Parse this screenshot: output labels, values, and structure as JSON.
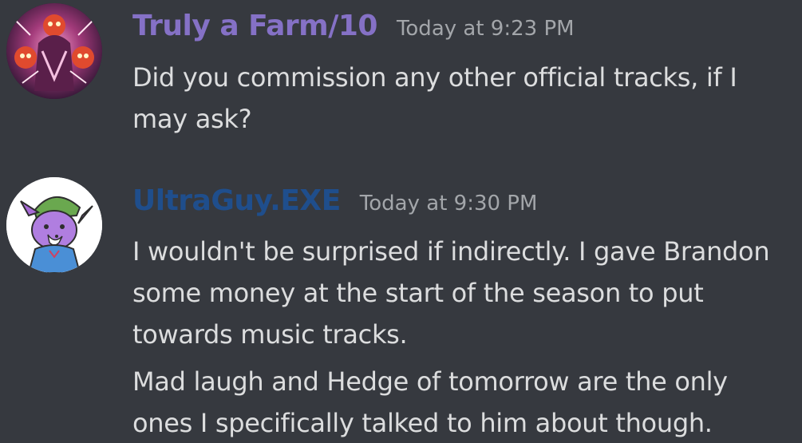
{
  "messages": [
    {
      "author": "Truly a Farm/10",
      "author_color": "#8571c6",
      "timestamp": "Today at 9:23 PM",
      "avatar_icon": "dark-jester-character-avatar",
      "content": [
        "Did you commission any other official tracks, if I may ask?"
      ]
    },
    {
      "author": "UltraGuy.EXE",
      "author_color": "#1f4e8c",
      "timestamp": "Today at 9:30 PM",
      "avatar_icon": "purple-fox-character-avatar",
      "content": [
        "I wouldn't be surprised if indirectly. I gave Brandon some money at the start of the season to put towards music tracks.",
        "Mad laugh and Hedge of tomorrow are the only ones I specifically talked to him about though."
      ]
    }
  ]
}
